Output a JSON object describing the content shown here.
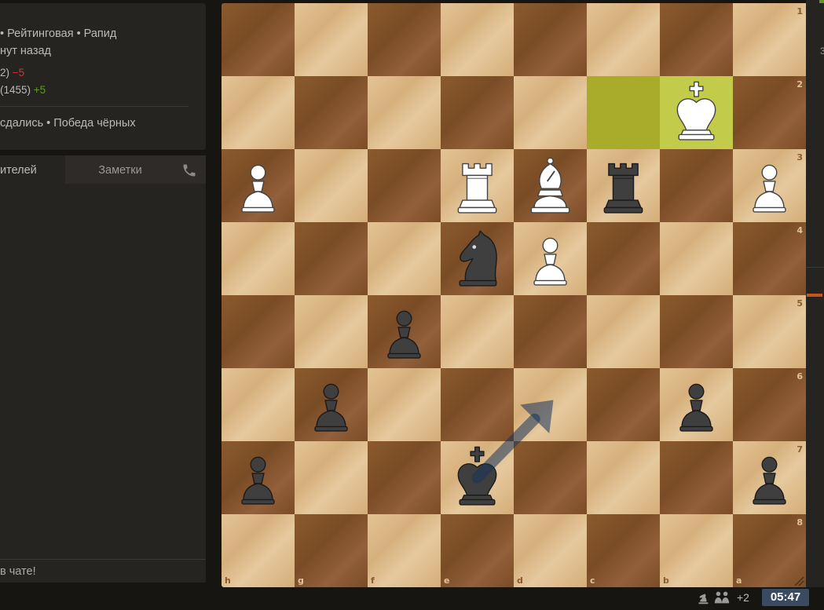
{
  "game_info": {
    "meta_line1": "• Рейтинговая • Рапид",
    "meta_line2": "нут назад",
    "player1_rating": "2)",
    "player1_diff": "−5",
    "player2_rating": "(1455)",
    "player2_diff": "+5",
    "result": "сдались • Победа чёрных"
  },
  "chat": {
    "tab_spectators": "ителей",
    "tab_notes": "Заметки",
    "input_placeholder": "в чате!"
  },
  "board": {
    "orientation": "black",
    "ranks_top_to_bottom": [
      "1",
      "2",
      "3",
      "4",
      "5",
      "6",
      "7",
      "8"
    ],
    "files_left_to_right": [
      "h",
      "g",
      "f",
      "e",
      "d",
      "c",
      "b",
      "a"
    ],
    "light_color": "#e3c496",
    "dark_color": "#8b5a2e",
    "last_move": [
      "c2",
      "b2"
    ],
    "pieces": [
      {
        "square": "b2",
        "piece": "wK"
      },
      {
        "square": "h3",
        "piece": "wP"
      },
      {
        "square": "e3",
        "piece": "wR"
      },
      {
        "square": "d3",
        "piece": "wB"
      },
      {
        "square": "c3",
        "piece": "bR"
      },
      {
        "square": "a3",
        "piece": "wP"
      },
      {
        "square": "e4",
        "piece": "bN"
      },
      {
        "square": "d4",
        "piece": "wP"
      },
      {
        "square": "f5",
        "piece": "bP"
      },
      {
        "square": "g6",
        "piece": "bP"
      },
      {
        "square": "b6",
        "piece": "bP"
      },
      {
        "square": "h7",
        "piece": "bP"
      },
      {
        "square": "e7",
        "piece": "bK"
      },
      {
        "square": "a7",
        "piece": "bP"
      }
    ],
    "arrow": {
      "from": "e7",
      "to": "d6",
      "color": "#15335a"
    }
  },
  "right_strip": {
    "mark": "3"
  },
  "bottom_bar": {
    "spectators_extra": "+2",
    "clock": "05:47"
  }
}
